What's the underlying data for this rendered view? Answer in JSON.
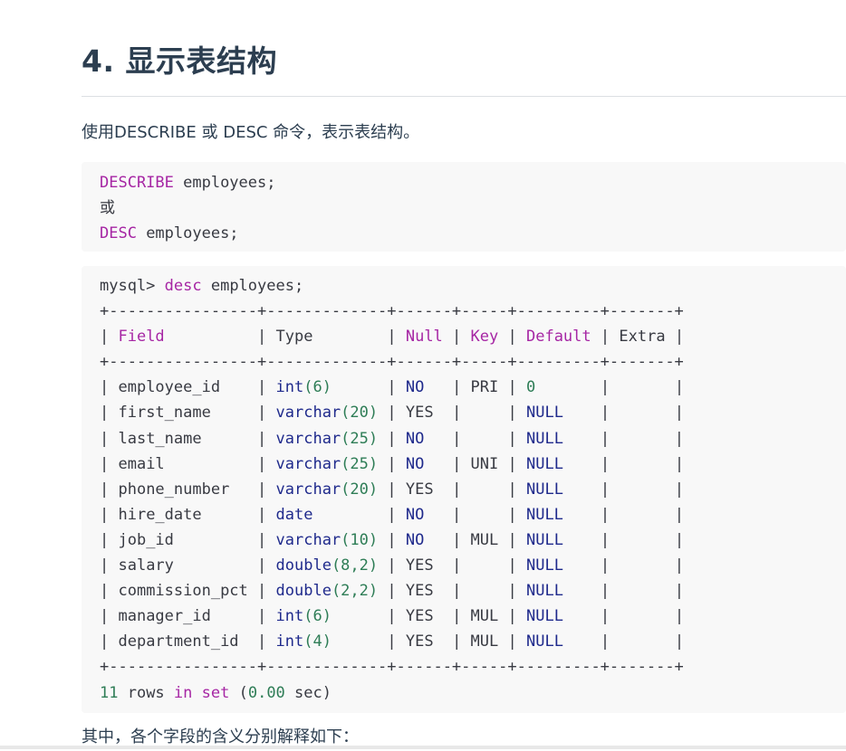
{
  "heading": "4. 显示表结构",
  "intro": "使用DESCRIBE 或 DESC 命令，表示表结构。",
  "code1": {
    "kw1": "DESCRIBE",
    "rest1": " employees;",
    "or": "或",
    "kw2": "DESC",
    "rest2": " employees;"
  },
  "code2": {
    "prompt": "mysql> ",
    "cmd": "desc",
    "cmd_rest": " employees;",
    "border": "+----------------+-------------+------+-----+---------+-------+",
    "headers": [
      "Field",
      "Type",
      "Null",
      "Key",
      "Default",
      "Extra"
    ],
    "rows": [
      {
        "field": "employee_id",
        "type_name": "int",
        "type_arg": "(6)",
        "null": "NO",
        "key": "PRI",
        "default": "0",
        "extra": ""
      },
      {
        "field": "first_name",
        "type_name": "varchar",
        "type_arg": "(20)",
        "null": "YES",
        "key": "",
        "default": "NULL",
        "extra": ""
      },
      {
        "field": "last_name",
        "type_name": "varchar",
        "type_arg": "(25)",
        "null": "NO",
        "key": "",
        "default": "NULL",
        "extra": ""
      },
      {
        "field": "email",
        "type_name": "varchar",
        "type_arg": "(25)",
        "null": "NO",
        "key": "UNI",
        "default": "NULL",
        "extra": ""
      },
      {
        "field": "phone_number",
        "type_name": "varchar",
        "type_arg": "(20)",
        "null": "YES",
        "key": "",
        "default": "NULL",
        "extra": ""
      },
      {
        "field": "hire_date",
        "type_name": "date",
        "type_arg": "",
        "null": "NO",
        "key": "",
        "default": "NULL",
        "extra": ""
      },
      {
        "field": "job_id",
        "type_name": "varchar",
        "type_arg": "(10)",
        "null": "NO",
        "key": "MUL",
        "default": "NULL",
        "extra": ""
      },
      {
        "field": "salary",
        "type_name": "double",
        "type_arg": "(8,2)",
        "null": "YES",
        "key": "",
        "default": "NULL",
        "extra": ""
      },
      {
        "field": "commission_pct",
        "type_name": "double",
        "type_arg": "(2,2)",
        "null": "YES",
        "key": "",
        "default": "NULL",
        "extra": ""
      },
      {
        "field": "manager_id",
        "type_name": "int",
        "type_arg": "(6)",
        "null": "YES",
        "key": "MUL",
        "default": "NULL",
        "extra": ""
      },
      {
        "field": "department_id",
        "type_name": "int",
        "type_arg": "(4)",
        "null": "YES",
        "key": "MUL",
        "default": "NULL",
        "extra": ""
      }
    ],
    "footer": {
      "count": "11",
      "rows_word": " rows ",
      "in": "in",
      "set": "set",
      "time_open": " (",
      "time_num": "0.00",
      "time_close": " sec)"
    }
  },
  "outro": "其中，各个字段的含义分别解释如下："
}
